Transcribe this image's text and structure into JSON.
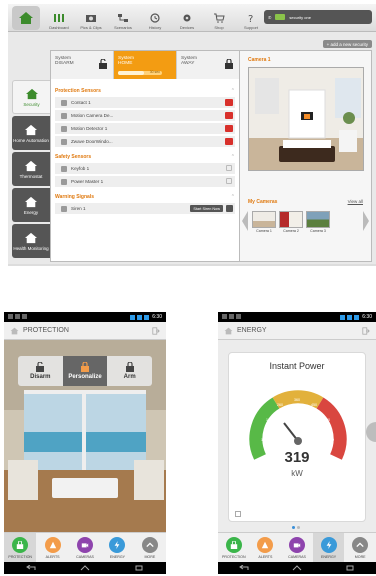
{
  "web": {
    "user_label": "security one",
    "add_device": "+ add a new security",
    "nav": [
      {
        "label": "Dashboard",
        "icon": "sliders-icon"
      },
      {
        "label": "Pics & Clips",
        "icon": "camera-icon"
      },
      {
        "label": "Scenarios",
        "icon": "scenario-icon"
      },
      {
        "label": "History",
        "icon": "clock-icon"
      },
      {
        "label": "Devices",
        "icon": "gear-icon"
      },
      {
        "label": "Shop",
        "icon": "cart-icon"
      },
      {
        "label": "Support",
        "icon": "question-icon"
      }
    ],
    "tabs": [
      {
        "label": "Security",
        "icon": "house-icon"
      },
      {
        "label": "Home Automation",
        "icon": "house-icon"
      },
      {
        "label": "Thermostat",
        "icon": "house-icon"
      },
      {
        "label": "Energy",
        "icon": "house-icon"
      },
      {
        "label": "Health Monitoring",
        "icon": "house-icon"
      }
    ],
    "modes": {
      "disarm": "System DISARM",
      "home": "System HOME",
      "home_timer": "30 sec",
      "away": "System AWAY"
    },
    "sections": {
      "protection_title": "Protection Sensors",
      "protection": [
        "Contact 1",
        "Motion Camera De...",
        "Motion Detector 1",
        "Zwave DoorWindo..."
      ],
      "safety_title": "Safety Sensors",
      "safety": [
        "Keyfob 1",
        "Power Master 1"
      ],
      "warning_title": "Warning Signals",
      "warning": [
        "Siren 1"
      ],
      "siren_button": "Start Siren Now"
    },
    "camera": {
      "title": "Camera 1",
      "my_cameras": "My Cameras",
      "view_all": "View all",
      "thumbs": [
        "Camera 1",
        "Camera 2",
        "Camera 3"
      ]
    }
  },
  "phone1": {
    "title": "PROTECTION",
    "time": "6:30",
    "modes": [
      "Disarm",
      "Personalize",
      "Arm"
    ]
  },
  "phone2": {
    "title": "ENERGY",
    "time": "6:30",
    "card_title": "Instant Power",
    "value": "319",
    "unit": "kW",
    "tick_labels": [
      "0",
      "100",
      "170",
      "260",
      "360",
      "450",
      "520",
      "600",
      "700"
    ]
  },
  "bottom_tabs": [
    "PROTECTION",
    "ALERTS",
    "CAMERAS",
    "ENERGY",
    "MORE"
  ],
  "colors": {
    "protection": "#3bb54a",
    "alerts": "#f39c4a",
    "cameras": "#8e44ad",
    "energy": "#3a9ad9",
    "more": "#888888",
    "accent": "#e07a10"
  }
}
